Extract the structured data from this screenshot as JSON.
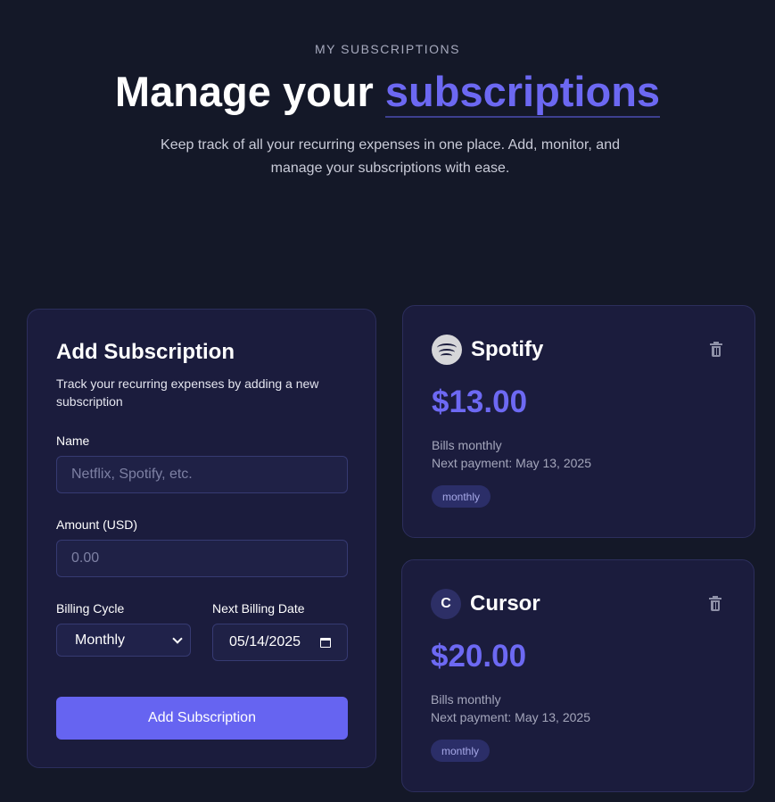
{
  "header": {
    "eyebrow": "MY SUBSCRIPTIONS",
    "title_prefix": "Manage your",
    "title_accent": "subscriptions",
    "subtitle": "Keep track of all your recurring expenses in one place. Add, monitor, and manage your subscriptions with ease."
  },
  "form": {
    "title": "Add Subscription",
    "description": "Track your recurring expenses by adding a new subscription",
    "name_label": "Name",
    "name_placeholder": "Netflix, Spotify, etc.",
    "amount_label": "Amount (USD)",
    "amount_placeholder": "0.00",
    "cycle_label": "Billing Cycle",
    "cycle_value": "Monthly",
    "date_label": "Next Billing Date",
    "date_value": "05/14/2025",
    "submit_label": "Add Subscription"
  },
  "subscriptions": [
    {
      "name": "Spotify",
      "icon": "spotify-logo",
      "price": "$13.00",
      "billing": "Bills monthly",
      "next_payment": "Next payment: May 13, 2025",
      "badge": "monthly"
    },
    {
      "name": "Cursor",
      "icon": "letter-avatar",
      "initial": "C",
      "price": "$20.00",
      "billing": "Bills monthly",
      "next_payment": "Next payment: May 13, 2025",
      "badge": "monthly"
    }
  ],
  "colors": {
    "background": "#141828",
    "card": "#1b1c3d",
    "accent": "#6c68f2",
    "badge": "#2b2e68"
  }
}
